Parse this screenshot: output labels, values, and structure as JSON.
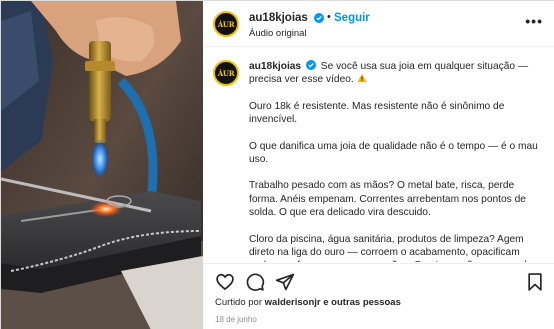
{
  "post": {
    "username": "au18kjoias",
    "avatar_text": "ÁUR",
    "follow_label": "Seguir",
    "separator": "•",
    "audio_label": "Áudio original",
    "more_label": "•••"
  },
  "caption": {
    "username": "au18kjoias",
    "lead": "Se você usa sua joia em qualquer situação — precisa ver esse vídeo.",
    "paragraphs": [
      "Ouro 18k é resistente. Mas resistente não é sinônimo de invencível.",
      "O que danifica uma joia de qualidade não é o tempo — é o mau uso.",
      "Trabalho pesado com as mãos? O metal bate, risca, perde forma. Anéis empenam. Correntes arrebentam nos pontos de solda. O que era delicado vira descuido.",
      "Cloro da piscina, água sanitária, produtos de limpeza? Agem direto na liga do ouro — corroem o acabamento, opacificam pedras, enfraquecem as cravações. O estrago não aparece de"
    ]
  },
  "actions": {
    "like_icon": "heart-icon",
    "comment_icon": "comment-icon",
    "share_icon": "share-icon",
    "save_icon": "bookmark-icon"
  },
  "likes": {
    "prefix": "Curtido por",
    "user": "walderisonjr",
    "suffix": "e outras pessoas"
  },
  "date": "18 de junho",
  "colors": {
    "accent": "#0095f6",
    "verified": "#0095f6",
    "text": "#262626",
    "muted": "#8e8e8e"
  }
}
